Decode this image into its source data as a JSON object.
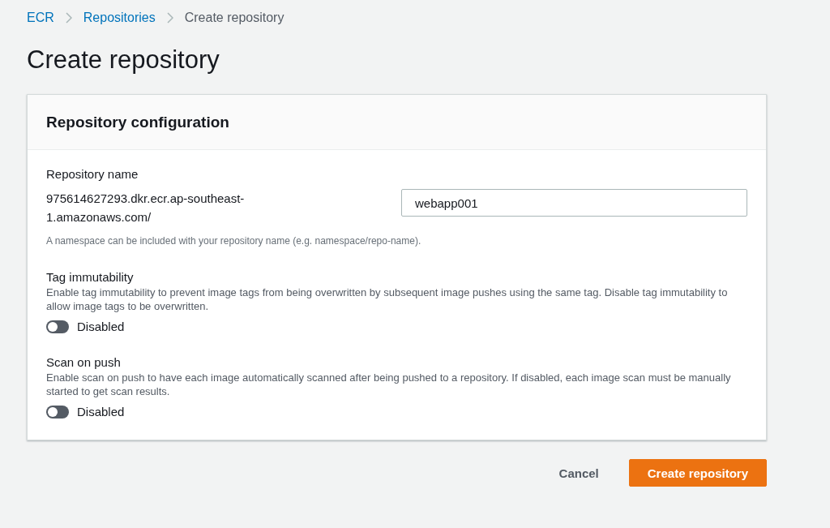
{
  "breadcrumbs": [
    {
      "label": "ECR",
      "kind": "link"
    },
    {
      "label": "Repositories",
      "kind": "link"
    },
    {
      "label": "Create repository",
      "kind": "current"
    }
  ],
  "title": "Create repository",
  "panel": {
    "title": "Repository configuration",
    "repository_name": {
      "label": "Repository name",
      "prefix_lines": [
        "975614627293.dkr.ecr.ap-southeast-",
        "1.amazonaws.com/"
      ],
      "value": "webapp001",
      "hint": "A namespace can be included with your repository name (e.g. namespace/repo-name)."
    },
    "settings": [
      {
        "label": "Tag immutability",
        "description": "Enable tag immutability to prevent image tags from being overwritten by subsequent image pushes using the same tag. Disable tag immutability to allow image tags to be overwritten.",
        "on": false,
        "state_label": "Disabled"
      },
      {
        "label": "Scan on push",
        "description": "Enable scan on push to have each image automatically scanned after being pushed to a repository. If disabled, each image scan must be manually started to get scan results.",
        "on": false,
        "state_label": "Disabled"
      }
    ]
  },
  "buttons": [
    {
      "label": "Cancel",
      "kind": "secondary"
    },
    {
      "label": "Create repository",
      "kind": "primary"
    }
  ]
}
